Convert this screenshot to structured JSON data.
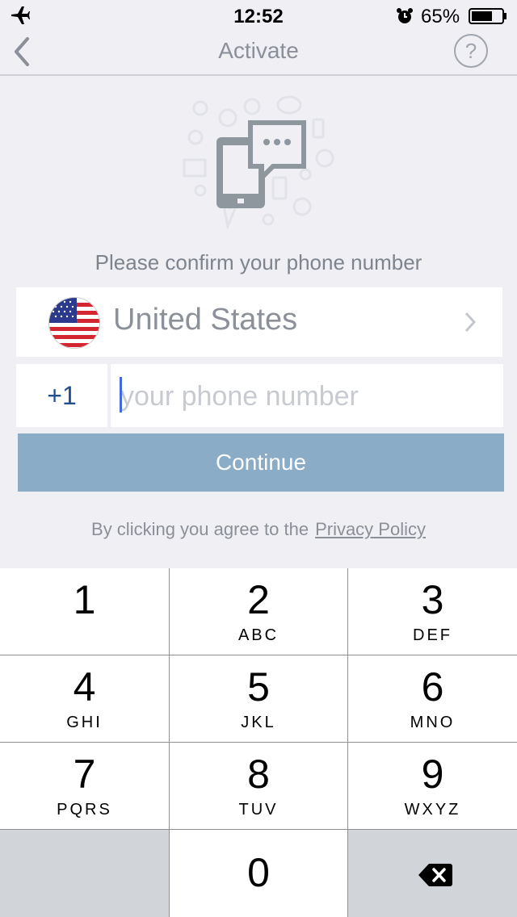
{
  "status_bar": {
    "time": "12:52",
    "battery_percent": "65%"
  },
  "nav": {
    "title": "Activate",
    "help_label": "?"
  },
  "prompt": "Please confirm your phone number",
  "country": {
    "name": "United States"
  },
  "phone": {
    "country_code": "+1",
    "placeholder": "your phone number",
    "value": ""
  },
  "continue_label": "Continue",
  "agreement": {
    "text": "By clicking you agree to the",
    "link": "Privacy Policy"
  },
  "keypad": {
    "keys": [
      {
        "num": "1",
        "letters": ""
      },
      {
        "num": "2",
        "letters": "ABC"
      },
      {
        "num": "3",
        "letters": "DEF"
      },
      {
        "num": "4",
        "letters": "GHI"
      },
      {
        "num": "5",
        "letters": "JKL"
      },
      {
        "num": "6",
        "letters": "MNO"
      },
      {
        "num": "7",
        "letters": "PQRS"
      },
      {
        "num": "8",
        "letters": "TUV"
      },
      {
        "num": "9",
        "letters": "WXYZ"
      },
      {
        "num": "0",
        "letters": ""
      }
    ]
  },
  "colors": {
    "continue_bg": "#8aacc6",
    "background": "#efeff4",
    "country_code": "#1f4f8f",
    "caret": "#4169e1"
  },
  "icons": [
    "airplane-icon",
    "alarm-icon",
    "battery-icon",
    "back-chevron-icon",
    "help-icon",
    "phone-chat-illustration",
    "us-flag-icon",
    "chevron-right-icon",
    "backspace-icon"
  ]
}
